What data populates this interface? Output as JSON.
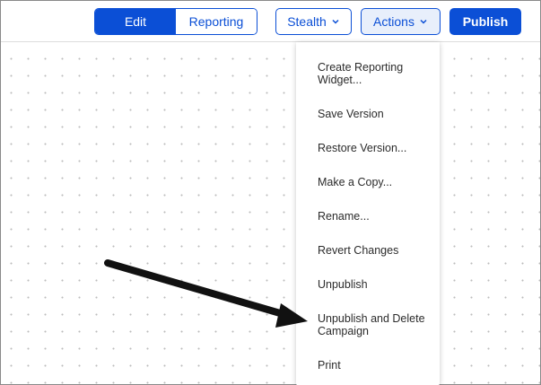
{
  "toolbar": {
    "edit_label": "Edit",
    "reporting_label": "Reporting",
    "stealth_label": "Stealth",
    "actions_label": "Actions",
    "publish_label": "Publish"
  },
  "actions_menu": {
    "items": [
      {
        "label": "Create Reporting Widget..."
      },
      {
        "label": "Save Version"
      },
      {
        "label": "Restore Version..."
      },
      {
        "label": "Make a Copy..."
      },
      {
        "label": "Rename..."
      },
      {
        "label": "Revert Changes"
      },
      {
        "label": "Unpublish"
      },
      {
        "label": "Unpublish and Delete Campaign"
      },
      {
        "label": "Print"
      }
    ]
  },
  "colors": {
    "accent": "#0b4fd6",
    "actions_bg": "#e8effb",
    "menu_text": "#2b2b2b",
    "arrow": "#111111"
  },
  "icons": {
    "dropdown": "chevron-down-icon",
    "annotation": "arrow-pointer"
  }
}
